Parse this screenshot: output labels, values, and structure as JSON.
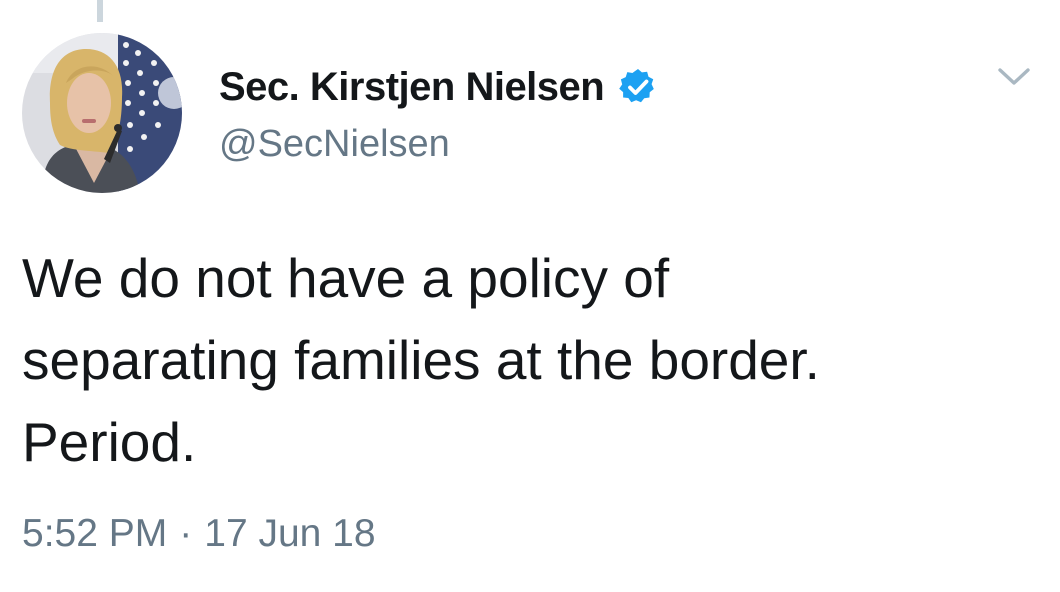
{
  "tweet": {
    "author": {
      "display_name": "Sec. Kirstjen Nielsen",
      "handle": "@SecNielsen",
      "verified": true,
      "avatar_icon": "profile-photo"
    },
    "text_lines": [
      "We do not have a policy of",
      "separating families at the border.",
      "Period."
    ],
    "time": "5:52 PM",
    "separator": "·",
    "date": "17 Jun 18"
  },
  "icons": {
    "verified": "verified-badge-icon",
    "menu": "chevron-down-icon"
  },
  "colors": {
    "text_primary": "#14171a",
    "text_secondary": "#657786",
    "verified_blue": "#1da1f2",
    "caret_gray": "#aab8c2",
    "thread_line": "#ccd6dd"
  }
}
